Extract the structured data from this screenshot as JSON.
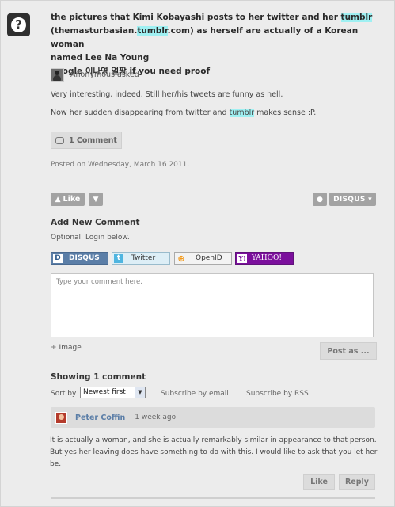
{
  "question": {
    "line1_pre": "the pictures that Kimi Kobayashi posts to her twitter and her ",
    "line1_hl": "tumblr",
    "line2_pre": "(themasturbasian.",
    "line2_hl": "tumblr",
    "line2_post": ".com) as herself are actually of a Korean woman",
    "line3": "named Lee Na Young",
    "line4": "google 이나영 얼짱 if you need proof"
  },
  "asker": {
    "label": "Anonymous asked"
  },
  "answer": {
    "p1": "Very interesting, indeed. Still her/his tweets are funny as hell.",
    "p2_pre": "Now her sudden disappearing from twitter and ",
    "p2_hl": "tumblr",
    "p2_post": " makes sense :P."
  },
  "comment_count_label": "1 Comment",
  "posted": "Posted on Wednesday, March 16 2011.",
  "toolbar": {
    "like_label": "Like",
    "disqus_label": "DISQUS ▾"
  },
  "add_comment": {
    "title": "Add New Comment",
    "optional": "Optional: Login below.",
    "logins": {
      "disqus": "DISQUS",
      "twitter": "Twitter",
      "openid": "OpenID",
      "yahoo": "YAHOO!"
    },
    "placeholder": "Type your comment here.",
    "image_label": "Image",
    "post_as": "Post as ..."
  },
  "comments_section": {
    "showing": "Showing 1 comment",
    "sort_by": "Sort by",
    "sort_value": "Newest first",
    "subscribe_email": "Subscribe by email",
    "subscribe_rss": "Subscribe by RSS"
  },
  "comment": {
    "author": "Peter Coffin",
    "time": "1 week ago",
    "text": "It is actually a woman, and she is actually remarkably similar in appearance to that person. But yes her leaving does have something to do with this. I would like to ask that you let her be.",
    "like_label": "Like",
    "reply_label": "Reply"
  }
}
